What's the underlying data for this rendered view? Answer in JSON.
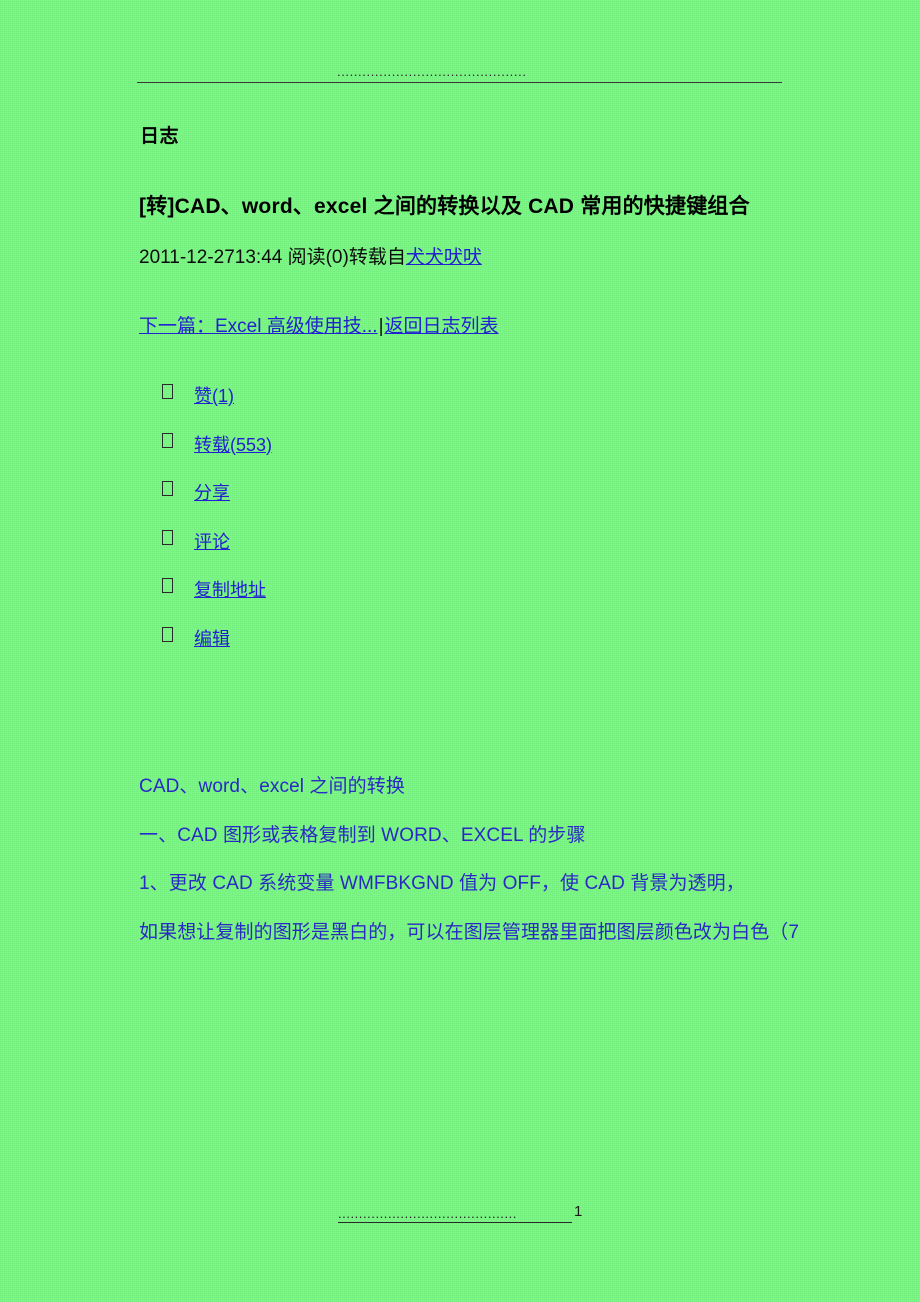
{
  "colors": {
    "background": "#7bfa85",
    "text": "#000000",
    "link": "#2222d8",
    "body_text": "#2a2acc",
    "rule": "#3a3a3a"
  },
  "header": {
    "dot_leader": ".............................................",
    "rule": true
  },
  "section": {
    "heading": "日志"
  },
  "article": {
    "title": "[转]CAD、word、excel 之间的转换以及 CAD 常用的快捷键组合",
    "meta": {
      "datetime": "2011-12-2713:44",
      "reads": " 阅读(0)转载自",
      "source_link": "犬犬吠吠"
    }
  },
  "nav": {
    "next_link": "下一篇：Excel 高级使用技...",
    "separator": "|",
    "back_link": "返回日志列表"
  },
  "actions": [
    {
      "marker": "tofu-box",
      "label": "赞(1)"
    },
    {
      "marker": "tofu-box",
      "label": "转载(553)"
    },
    {
      "marker": "tofu-box",
      "label": "分享"
    },
    {
      "marker": "tofu-box",
      "label": "评论"
    },
    {
      "marker": "tofu-box",
      "label": "复制地址"
    },
    {
      "marker": "tofu-box",
      "label": "编辑"
    }
  ],
  "body": {
    "lines": [
      "CAD、word、excel 之间的转换",
      "一、CAD 图形或表格复制到 WORD、EXCEL 的步骤",
      "1、更改 CAD 系统变量 WMFBKGND 值为 OFF，使 CAD 背景为透明，",
      "如果想让复制的图形是黑白的，可以在图层管理器里面把图层颜色改为白色（7"
    ]
  },
  "footer": {
    "dot_leader": "...........................................",
    "page_number": "1"
  }
}
